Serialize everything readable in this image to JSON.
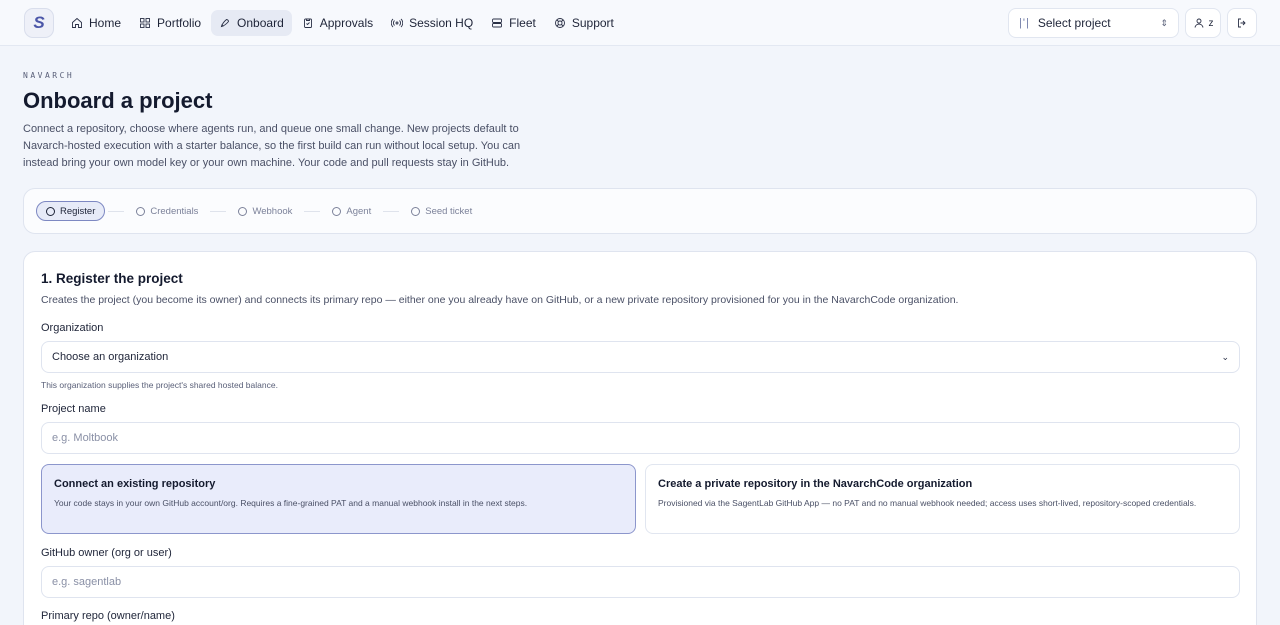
{
  "nav": {
    "logo": "S",
    "items": [
      {
        "label": "Home",
        "icon": "home-icon"
      },
      {
        "label": "Portfolio",
        "icon": "grid-icon"
      },
      {
        "label": "Onboard",
        "icon": "rocket-icon",
        "active": true
      },
      {
        "label": "Approvals",
        "icon": "clipboard-icon"
      },
      {
        "label": "Session HQ",
        "icon": "broadcast-icon"
      },
      {
        "label": "Fleet",
        "icon": "server-icon"
      },
      {
        "label": "Support",
        "icon": "lifebuoy-icon"
      }
    ],
    "project_select": "Select project",
    "user_initial": "z"
  },
  "header": {
    "eyebrow": "NAVARCH",
    "title": "Onboard a project",
    "intro": "Connect a repository, choose where agents run, and queue one small change. New projects default to Navarch-hosted execution with a starter balance, so the first build can run without local setup. You can instead bring your own model key or your own machine. Your code and pull requests stay in GitHub."
  },
  "stepper": {
    "steps": [
      {
        "label": "Register",
        "active": true
      },
      {
        "label": "Credentials"
      },
      {
        "label": "Webhook"
      },
      {
        "label": "Agent"
      },
      {
        "label": "Seed ticket"
      }
    ]
  },
  "register": {
    "heading": "1. Register the project",
    "description": "Creates the project (you become its owner) and connects its primary repo — either one you already have on GitHub, or a new private repository provisioned for you in the NavarchCode organization.",
    "org_label": "Organization",
    "org_value": "Choose an organization",
    "org_hint": "This organization supplies the project's shared hosted balance.",
    "name_label": "Project name",
    "name_placeholder": "e.g. Moltbook",
    "option_existing_title": "Connect an existing repository",
    "option_existing_desc": "Your code stays in your own GitHub account/org. Requires a fine-grained PAT and a manual webhook install in the next steps.",
    "option_new_title": "Create a private repository in the NavarchCode organization",
    "option_new_desc": "Provisioned via the SagentLab GitHub App — no PAT and no manual webhook needed; access uses short-lived, repository-scoped credentials.",
    "owner_label": "GitHub owner (org or user)",
    "owner_placeholder": "e.g. sagentlab",
    "repo_label": "Primary repo (owner/name)"
  },
  "colors": {
    "accent": "#7d88c2",
    "selected_bg": "#e9ecfb",
    "page_bg": "#f2f5fb"
  }
}
